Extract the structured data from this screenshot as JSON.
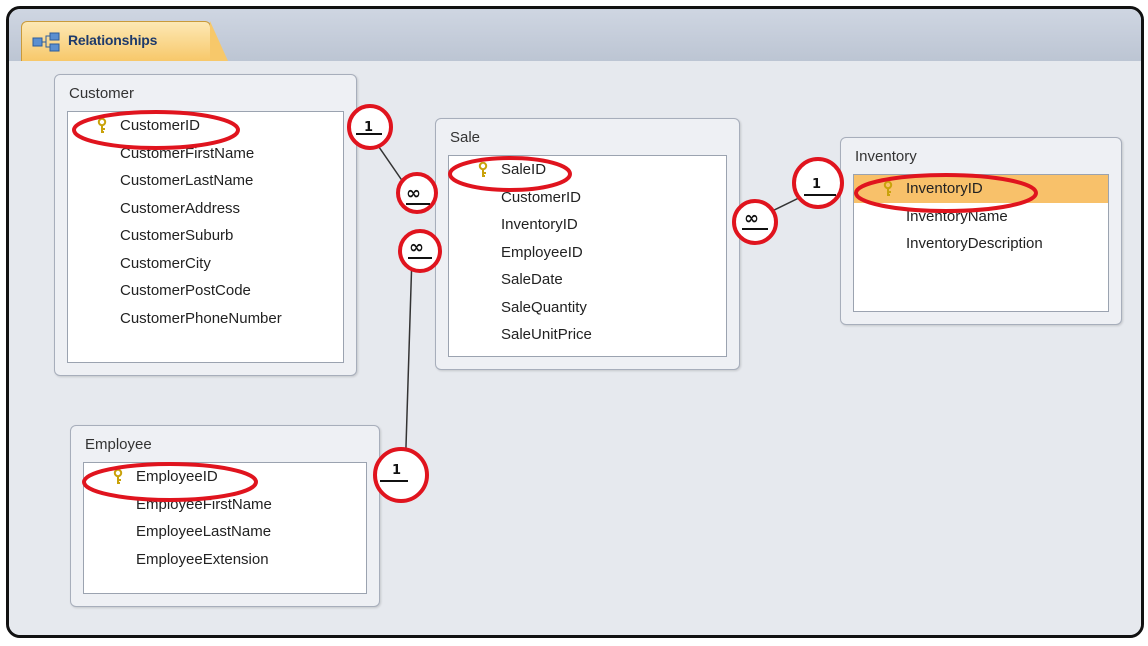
{
  "tab": {
    "label": "Relationships",
    "icon": "relationships-icon"
  },
  "colors": {
    "highlight": "#e0141e",
    "selected_row": "#f8c16a",
    "tab": "#f7c86a"
  },
  "tables": {
    "customer": {
      "title": "Customer",
      "fields": [
        "CustomerID",
        "CustomerFirstName",
        "CustomerLastName",
        "CustomerAddress",
        "CustomerSuburb",
        "CustomerCity",
        "CustomerPostCode",
        "CustomerPhoneNumber"
      ]
    },
    "sale": {
      "title": "Sale",
      "fields": [
        "SaleID",
        "CustomerID",
        "InventoryID",
        "EmployeeID",
        "SaleDate",
        "SaleQuantity",
        "SaleUnitPrice"
      ]
    },
    "inventory": {
      "title": "Inventory",
      "fields": [
        "InventoryID",
        "InventoryName",
        "InventoryDescription"
      ]
    },
    "employee": {
      "title": "Employee",
      "fields": [
        "EmployeeID",
        "EmployeeFirstName",
        "EmployeeLastName",
        "EmployeeExtension"
      ]
    }
  },
  "cardinality": {
    "one": "1",
    "many": "∞"
  }
}
